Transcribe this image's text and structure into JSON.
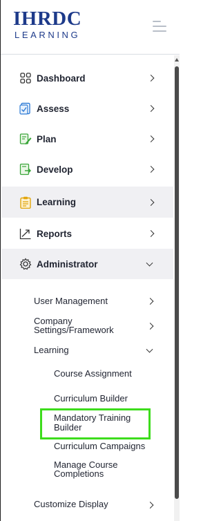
{
  "brand": {
    "name": "IHRDC",
    "tagline": "LEARNING"
  },
  "nav": {
    "dashboard": "Dashboard",
    "assess": "Assess",
    "plan": "Plan",
    "develop": "Develop",
    "learning": "Learning",
    "reports": "Reports",
    "administrator": "Administrator"
  },
  "admin_menu": {
    "user_management": "User Management",
    "company_settings_line1": "Company",
    "company_settings_line2": "Settings/Framework",
    "learning": "Learning",
    "customize_display": "Customize Display"
  },
  "learning_menu": {
    "course_assignment": "Course Assignment",
    "curriculum_builder": "Curriculum Builder",
    "mandatory_line1": "Mandatory Training",
    "mandatory_line2": "Builder",
    "curriculum_campaigns": "Curriculum Campaigns",
    "manage_line1": "Manage Course",
    "manage_line2": "Completions"
  },
  "colors": {
    "brand": "#1d3a8a",
    "highlight": "#3ddc1c",
    "active_bg": "#f0f0f3"
  },
  "icons": {
    "dashboard": "grid-icon",
    "assess": "check-clipboard-icon",
    "plan": "pencil-note-icon",
    "develop": "document-arrow-icon",
    "learning": "clipboard-icon",
    "reports": "trend-arrow-icon",
    "administrator": "gear-icon"
  }
}
